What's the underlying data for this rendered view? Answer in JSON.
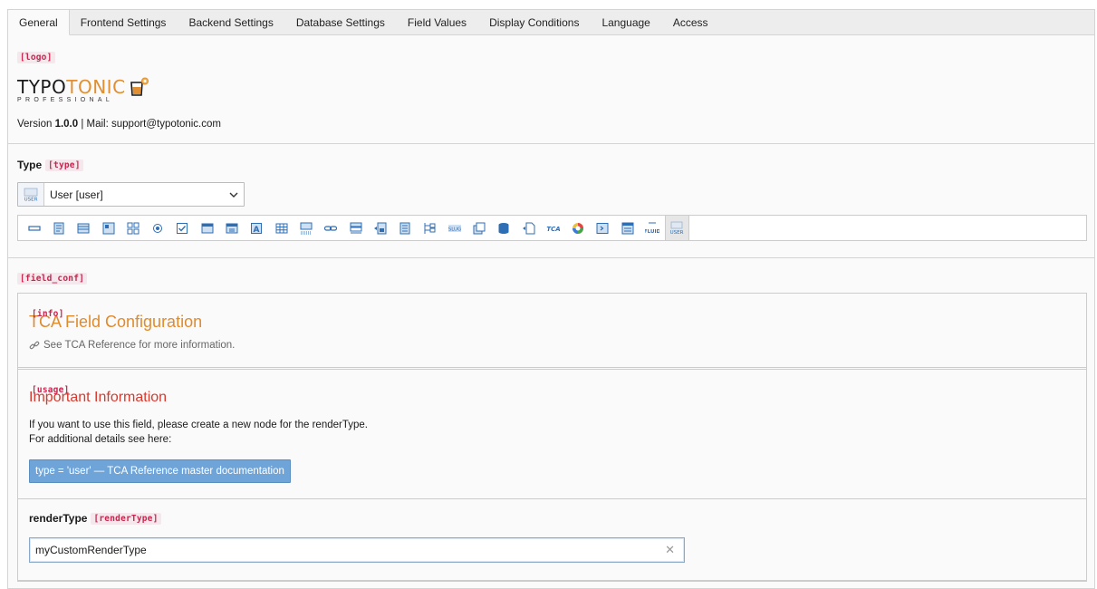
{
  "tabs": [
    {
      "label": "General",
      "active": true
    },
    {
      "label": "Frontend Settings"
    },
    {
      "label": "Backend Settings"
    },
    {
      "label": "Database Settings"
    },
    {
      "label": "Field Values"
    },
    {
      "label": "Display Conditions"
    },
    {
      "label": "Language"
    },
    {
      "label": "Access"
    }
  ],
  "general": {
    "logo_tag": "[logo]",
    "logo_word_1": "TYPO",
    "logo_word_2": "TONIC",
    "logo_sub": "PROFESSIONAL",
    "version_prefix": "Version",
    "version_number": "1.0.0",
    "mail_text": "| Mail: support@typotonic.com"
  },
  "type": {
    "label": "Type",
    "tag": "[type]",
    "selected": "User [user]",
    "icon_names": [
      "input-icon",
      "text-icon",
      "textarea-icon",
      "rte-icon",
      "group-icon",
      "radio-icon",
      "checkbox-icon",
      "select-icon",
      "select-multi-icon",
      "text-a-icon",
      "table-icon",
      "imgmanip-icon",
      "link-icon",
      "inline-icon",
      "file-icon",
      "file-list-icon",
      "flexform-icon",
      "slug-icon",
      "folder-icon",
      "database-icon",
      "import-icon",
      "tca-icon",
      "color-icon",
      "code-icon",
      "form-icon",
      "fluid-icon",
      "user-icon"
    ]
  },
  "field_conf": {
    "tag": "[field_conf]",
    "info": {
      "tag": "[info]",
      "heading": "TCA Field Configuration",
      "link": "See TCA Reference for more information."
    },
    "usage": {
      "tag": "[usage]",
      "heading": "Important Information",
      "line1": "If you want to use this field, please create a new node for the renderType.",
      "line2": "For additional details see here:",
      "button": "type = 'user' — TCA Reference master documentation"
    },
    "render_type": {
      "label": "renderType",
      "tag": "[renderType]",
      "value": "myCustomRenderType"
    }
  },
  "colors": {
    "accent_orange": "#e08b2c",
    "alert_red": "#d8392e",
    "button_blue": "#6fa4d9",
    "tag_red": "#c7254e"
  }
}
